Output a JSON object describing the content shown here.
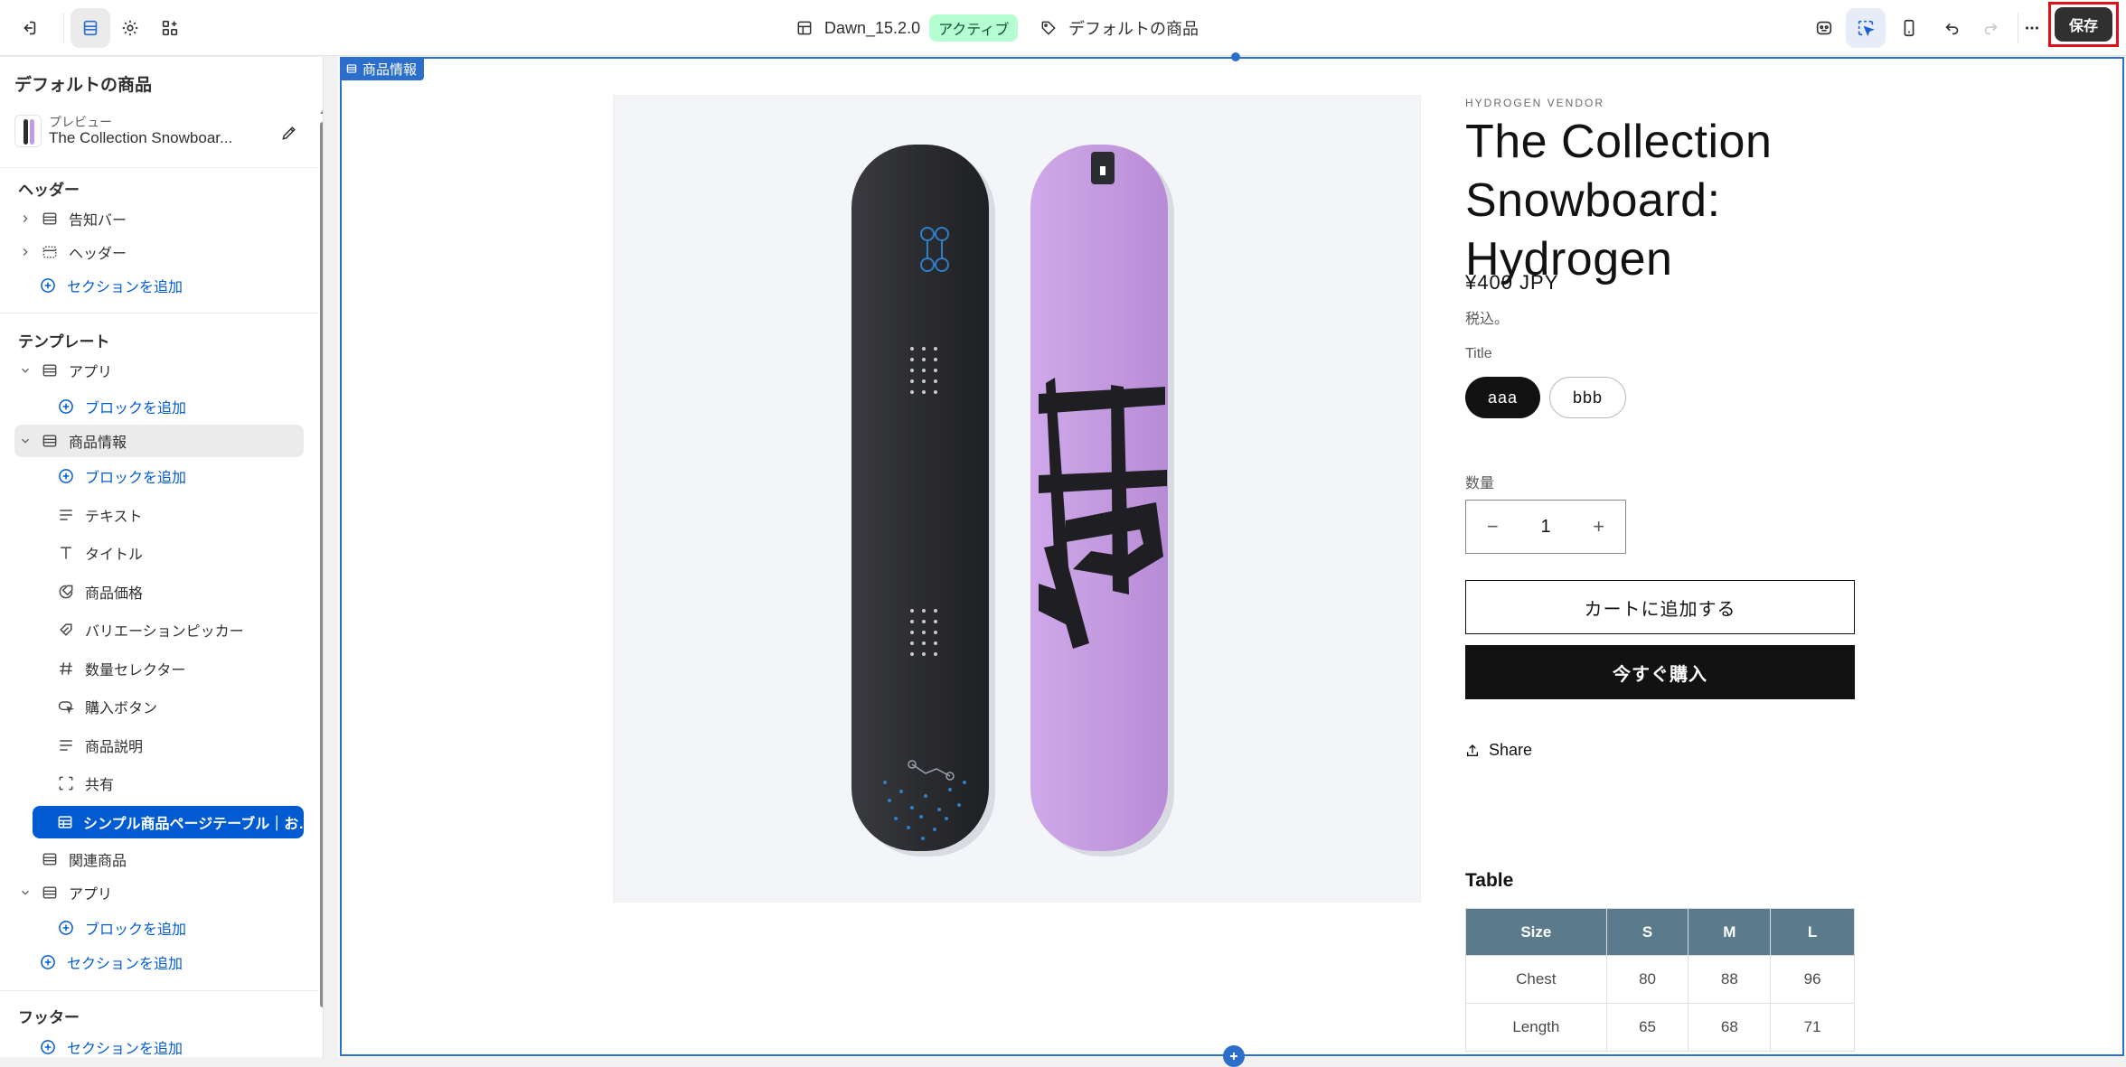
{
  "topbar": {
    "theme_name": "Dawn_15.2.0",
    "theme_status": "アクティブ",
    "template_label": "デフォルトの商品",
    "save_label": "保存"
  },
  "sidebar": {
    "title": "デフォルトの商品",
    "preview_label": "プレビュー",
    "preview_product": "The Collection Snowboar...",
    "header_group": {
      "heading": "ヘッダー",
      "items": [
        "告知バー",
        "ヘッダー"
      ],
      "add_section": "セクションを追加"
    },
    "template_group": {
      "heading": "テンプレート",
      "app1": "アプリ",
      "add_block_1": "ブロックを追加",
      "product_info": "商品情報",
      "add_block_2": "ブロックを追加",
      "blocks": [
        "テキスト",
        "タイトル",
        "商品価格",
        "バリエーションピッカー",
        "数量セレクター",
        "購入ボタン",
        "商品説明",
        "共有"
      ],
      "selected_block": "シンプル商品ページテーブル｜お…",
      "related": "関連商品",
      "app2": "アプリ",
      "add_block_3": "ブロックを追加",
      "add_section": "セクションを追加"
    },
    "footer_group": {
      "heading": "フッター",
      "add_section": "セクションを追加"
    }
  },
  "canvas": {
    "section_tag": "商品情報",
    "product": {
      "vendor": "HYDROGEN VENDOR",
      "title": "The Collection Snowboard: Hydrogen",
      "price": "¥400 JPY",
      "tax_note": "税込。",
      "option_label": "Title",
      "options": [
        "aaa",
        "bbb"
      ],
      "selected_option": "aaa",
      "quantity_label": "数量",
      "quantity": "1",
      "add_to_cart": "カートに追加する",
      "buy_now": "今すぐ購入",
      "share": "Share",
      "table_title": "Table",
      "table": {
        "headers": [
          "Size",
          "S",
          "M",
          "L"
        ],
        "rows": [
          [
            "Chest",
            "80",
            "88",
            "96"
          ],
          [
            "Length",
            "65",
            "68",
            "71"
          ]
        ]
      }
    }
  },
  "colors": {
    "accent": "#005bd3",
    "selection": "#2c6ecb",
    "save_highlight": "#e0101a",
    "table_header": "#5b7a8b",
    "board_dark": "#2b2c30",
    "board_purple": "#c49be0"
  }
}
